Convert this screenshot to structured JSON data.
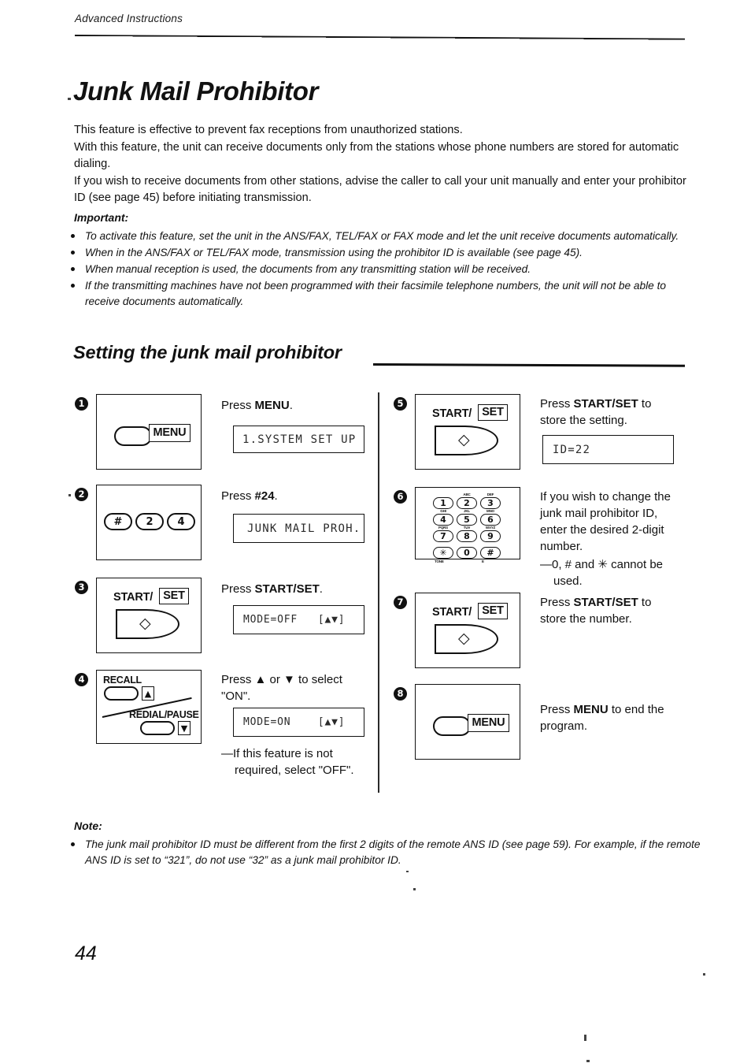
{
  "header": {
    "running_head": "Advanced Instructions"
  },
  "title": "Junk Mail Prohibitor",
  "intro": [
    "This feature is effective to prevent fax receptions from unauthorized stations.",
    "With this feature, the unit can receive documents only from the stations whose phone numbers are stored for automatic dialing.",
    "If you wish to receive documents from other stations, advise the caller to call your unit manually and enter your prohibitor ID (see page 45) before initiating transmission."
  ],
  "important": {
    "heading": "Important:",
    "items": [
      "To activate this feature, set the unit in the ANS/FAX, TEL/FAX or FAX mode and let the unit receive documents automatically.",
      "When in the ANS/FAX or TEL/FAX mode, transmission using the prohibitor ID is available (see page 45).",
      "When manual reception is used, the documents from any transmitting station will be received.",
      "If the transmitting machines have not been programmed with their facsimile telephone numbers, the unit will not be able to receive documents automatically."
    ]
  },
  "section": {
    "heading": "Setting the junk mail prohibitor"
  },
  "steps": [
    {
      "number": "1",
      "instruction_plain": "Press ",
      "instruction_bold": "MENU",
      "instruction_tail": ".",
      "lcd": "1.SYSTEM SET UP",
      "art": "menu-button",
      "menu_label": "MENU"
    },
    {
      "number": "2",
      "instruction_plain": "Press ",
      "instruction_bold": "#24",
      "instruction_tail": ".",
      "lcd": "JUNK MAIL PROH.",
      "art": "three-keys",
      "keys": [
        "#",
        "2",
        "4"
      ]
    },
    {
      "number": "3",
      "instruction_plain": "Press ",
      "instruction_bold": "START/SET",
      "instruction_tail": ".",
      "lcd": "MODE=OFF   [▲▼]",
      "art": "start-set-button",
      "start_label_a": "START/",
      "start_label_b": "SET"
    },
    {
      "number": "4",
      "instruction_plain": "Press ▲ or ▼ to select",
      "instruction_line2": "\"ON\".",
      "lcd": "MODE=ON    [▲▼]",
      "subnote_line1": "—If this feature is not",
      "subnote_line2": "required, select \"OFF\".",
      "art": "recall-redial-buttons",
      "recall_label": "RECALL",
      "redial_label": "REDIAL/PAUSE",
      "up_arrow": "▲",
      "down_arrow": "▼"
    },
    {
      "number": "5",
      "instruction_plain": "Press ",
      "instruction_bold": "START/SET",
      "instruction_tail": " to",
      "instruction_line2": "store the setting.",
      "lcd": "ID=22",
      "art": "start-set-button",
      "start_label_a": "START/",
      "start_label_b": "SET"
    },
    {
      "number": "6",
      "instruction_line1": "If you wish to change the",
      "instruction_line2": "junk mail prohibitor ID,",
      "instruction_line3": "enter the desired 2-digit",
      "instruction_line4": "number.",
      "subnote_line1": "—0, # and ✳ cannot be",
      "subnote_line2": "used.",
      "art": "dial-keypad",
      "keypad": [
        {
          "digit": "1",
          "sub": ""
        },
        {
          "digit": "2",
          "sub": "ABC"
        },
        {
          "digit": "3",
          "sub": "DEF"
        },
        {
          "digit": "4",
          "sub": "GHI"
        },
        {
          "digit": "5",
          "sub": "JKL"
        },
        {
          "digit": "6",
          "sub": "MNO"
        },
        {
          "digit": "7",
          "sub": "PQRS"
        },
        {
          "digit": "8",
          "sub": "TUV"
        },
        {
          "digit": "9",
          "sub": "WXYZ"
        },
        {
          "digit": "✳",
          "sub": "TONE"
        },
        {
          "digit": "0",
          "sub": ""
        },
        {
          "digit": "#",
          "sub": "E"
        }
      ]
    },
    {
      "number": "7",
      "instruction_plain": "Press ",
      "instruction_bold": "START/SET",
      "instruction_tail": " to",
      "instruction_line2": "store the number.",
      "art": "start-set-button",
      "start_label_a": "START/",
      "start_label_b": "SET"
    },
    {
      "number": "8",
      "instruction_plain": "Press ",
      "instruction_bold": "MENU",
      "instruction_tail": " to end the",
      "instruction_line2": "program.",
      "art": "menu-button",
      "menu_label": "MENU"
    }
  ],
  "note": {
    "heading": "Note:",
    "items": [
      "The junk mail prohibitor ID must be different from the first 2 digits of the remote ANS ID (see page 59). For example, if the remote ANS ID is set to “321”, do not use “32” as a junk mail prohibitor ID."
    ]
  },
  "folio": "44"
}
